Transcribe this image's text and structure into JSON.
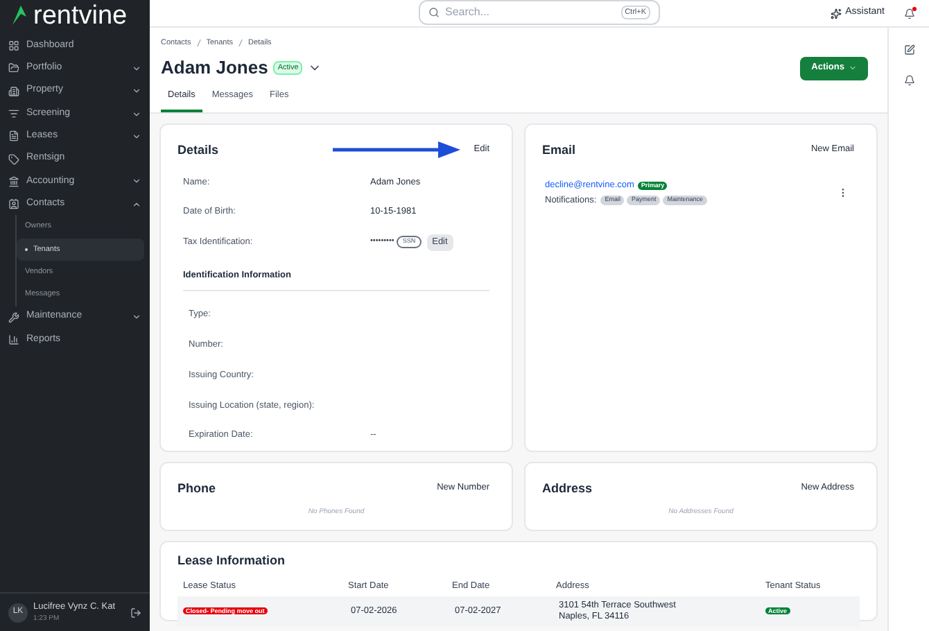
{
  "brand": "rentvine",
  "sidebar": {
    "items": [
      {
        "label": "Dashboard",
        "kind": "link"
      },
      {
        "label": "Portfolio",
        "kind": "group",
        "expanded": false
      },
      {
        "label": "Property",
        "kind": "group",
        "expanded": false
      },
      {
        "label": "Screening",
        "kind": "group",
        "expanded": false
      },
      {
        "label": "Leases",
        "kind": "group",
        "expanded": false
      },
      {
        "label": "Rentsign",
        "kind": "link"
      },
      {
        "label": "Accounting",
        "kind": "group",
        "expanded": false
      },
      {
        "label": "Contacts",
        "kind": "group",
        "expanded": true,
        "children": [
          {
            "label": "Owners",
            "selected": false
          },
          {
            "label": "Tenants",
            "selected": true
          },
          {
            "label": "Vendors",
            "selected": false
          },
          {
            "label": "Messages",
            "selected": false
          }
        ]
      },
      {
        "label": "Maintenance",
        "kind": "group",
        "expanded": false
      },
      {
        "label": "Reports",
        "kind": "link"
      }
    ]
  },
  "user": {
    "initials": "LK",
    "name": "Lucifree Vynz C. Kat",
    "time": "1:23 PM"
  },
  "search": {
    "placeholder": "Search...",
    "shortcut": "Ctrl+K"
  },
  "assistant": "Assistant",
  "notifications_unread": true,
  "breadcrumbs": [
    "Contacts",
    "Tenants",
    "Details"
  ],
  "title": "Adam Jones",
  "status": "Active",
  "actions": "Actions",
  "tabs": [
    {
      "label": "Details",
      "selected": true
    },
    {
      "label": "Messages",
      "selected": false
    },
    {
      "label": "Files",
      "selected": false
    }
  ],
  "details": {
    "title": "Details",
    "edit": "Edit",
    "fields": [
      {
        "label": "Name:",
        "value": "Adam Jones"
      },
      {
        "label": "Date of Birth:",
        "value": "10-15-1981"
      }
    ],
    "tax": {
      "label": "Tax Identification:",
      "value": "•••••••••",
      "badge": "SSN",
      "button": "Edit"
    },
    "id_title": "Identification Information",
    "id_fields": [
      {
        "label": "Type:"
      },
      {
        "label": "Number:"
      },
      {
        "label": "Issuing Country:"
      },
      {
        "label": "Issuing Location (state, region):"
      },
      {
        "label": "Expiration Date:",
        "value": "--"
      }
    ]
  },
  "email": {
    "title": "Email",
    "action": "New Email",
    "address": "decline@rentvine.com",
    "badge": "Primary",
    "notifications_label": "Notifications:",
    "tags": [
      "Email",
      "Payment",
      "Maintenance"
    ]
  },
  "phone": {
    "title": "Phone",
    "action": "New Number",
    "empty": "No Phones Found"
  },
  "address": {
    "title": "Address",
    "action": "New Address",
    "empty": "No Addresses Found"
  },
  "lease": {
    "title": "Lease Information",
    "columns": [
      "Lease Status",
      "Start Date",
      "End Date",
      "Address",
      "Tenant Status"
    ],
    "rows": [
      {
        "lease_status": "Closed- Pending move out",
        "start": "07-02-2026",
        "end": "07-02-2027",
        "address": [
          "3101 54th Terrace Southwest",
          "Naples, FL 34116"
        ],
        "tenant_status": "Active"
      }
    ]
  }
}
